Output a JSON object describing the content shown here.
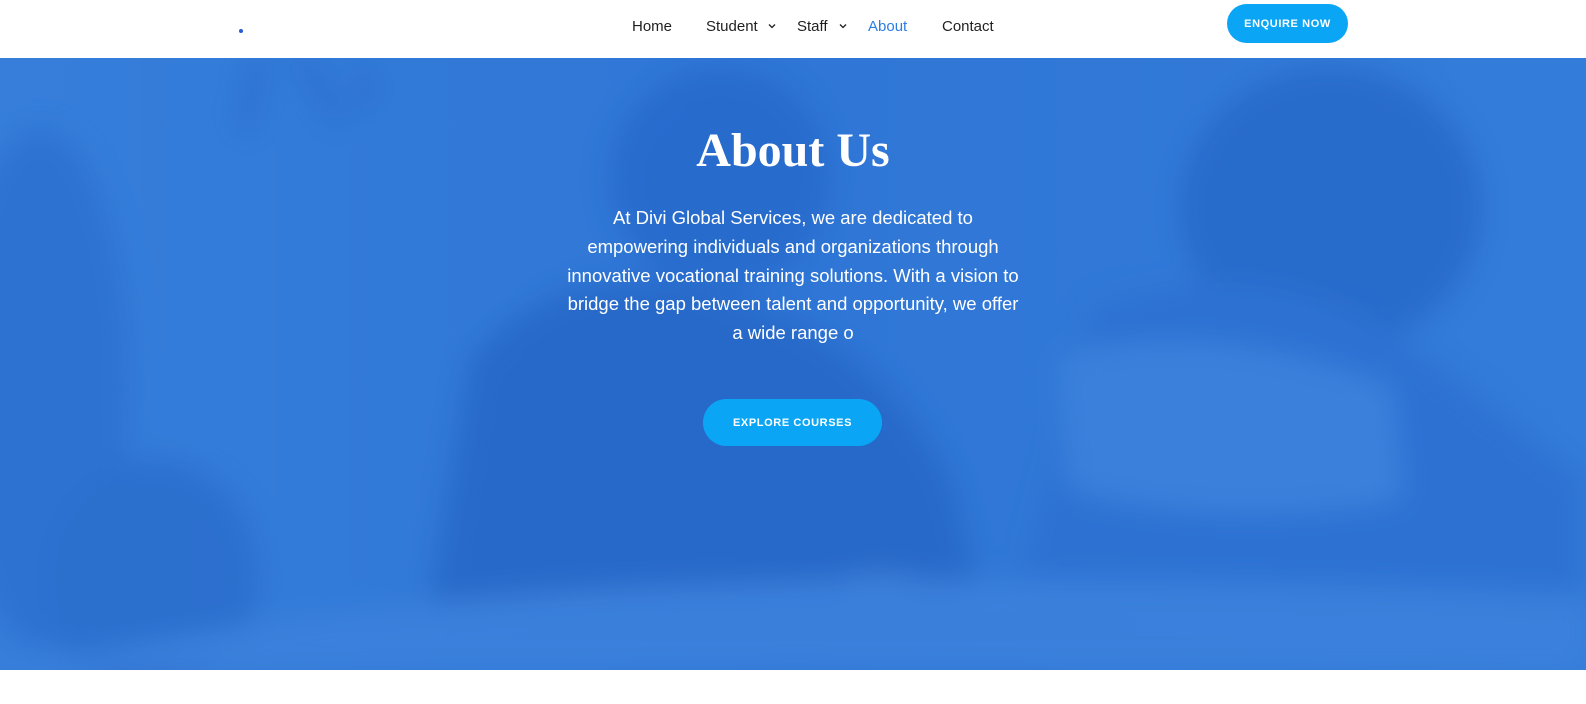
{
  "header": {
    "nav": [
      {
        "label": "Home",
        "has_dropdown": false,
        "active": false
      },
      {
        "label": "Student",
        "has_dropdown": true,
        "active": false
      },
      {
        "label": "Staff",
        "has_dropdown": true,
        "active": false
      },
      {
        "label": "About",
        "has_dropdown": false,
        "active": true
      },
      {
        "label": "Contact",
        "has_dropdown": false,
        "active": false
      }
    ],
    "cta_label": "ENQUIRE NOW"
  },
  "hero": {
    "title": "About Us",
    "body": "At Divi Global Services, we are dedicated to empowering individuals and organizations through innovative vocational training solutions. With a vision to bridge the gap between talent and opportunity, we offer a wide range o",
    "cta_label": "EXPLORE COURSES"
  },
  "icons": {
    "dropdown": "chevron-down-icon"
  },
  "colors": {
    "accent_button": "#0aa6f5",
    "active_nav": "#2b7de0",
    "hero_overlay": "#2f78d8",
    "logo_dot": "#2a5bd7"
  }
}
